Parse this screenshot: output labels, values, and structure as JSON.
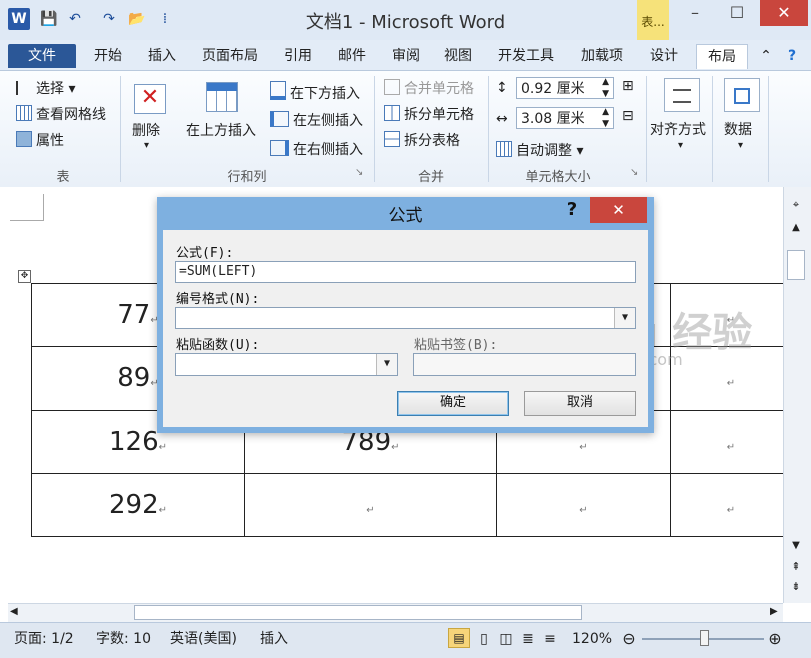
{
  "window": {
    "title": "文档1 - Microsoft Word",
    "contextual_tab": "表..."
  },
  "qat": {
    "logo": "W",
    "save": "💾",
    "undo": "↶",
    "redo": "↷",
    "open": "📂",
    "more": "⁞"
  },
  "tabs": [
    "文件",
    "开始",
    "插入",
    "页面布局",
    "引用",
    "邮件",
    "审阅",
    "视图",
    "开发工具",
    "加载项",
    "设计",
    "布局"
  ],
  "ribbon": {
    "table_group": {
      "label": "表",
      "select": "选择",
      "gridlines": "查看网格线",
      "properties": "属性"
    },
    "rows_cols_group": {
      "label": "行和列",
      "delete": "删除",
      "insert_above": "在上方插入",
      "insert_below": "在下方插入",
      "insert_left": "在左侧插入",
      "insert_right": "在右侧插入"
    },
    "merge_group": {
      "label": "合并",
      "merge_cells": "合并单元格",
      "split_cells": "拆分单元格",
      "split_table": "拆分表格"
    },
    "cell_size_group": {
      "label": "单元格大小",
      "height": "0.92 厘米",
      "width": "3.08 厘米",
      "autofit": "自动调整"
    },
    "align": "对齐方式",
    "data": "数据"
  },
  "document": {
    "rows": [
      {
        "a": "77",
        "b": ""
      },
      {
        "a": "89",
        "b": ""
      },
      {
        "a": "126",
        "b": "789"
      },
      {
        "a": "292",
        "b": ""
      }
    ],
    "para_mark": "↵"
  },
  "dialog": {
    "title": "公式",
    "help": "?",
    "close": "✕",
    "formula_label": "公式(F):",
    "formula_value": "=SUM(LEFT)",
    "number_format_label": "编号格式(N):",
    "paste_function_label": "粘贴函数(U):",
    "paste_bookmark_label": "粘贴书签(B):",
    "ok": "确定",
    "cancel": "取消"
  },
  "watermark": {
    "main": "Baidu 经验",
    "sub": "jingyan.baidu.com"
  },
  "statusbar": {
    "page": "页面: 1/2",
    "words": "字数: 10",
    "language": "英语(美国)",
    "mode": "插入",
    "zoom": "120%"
  }
}
